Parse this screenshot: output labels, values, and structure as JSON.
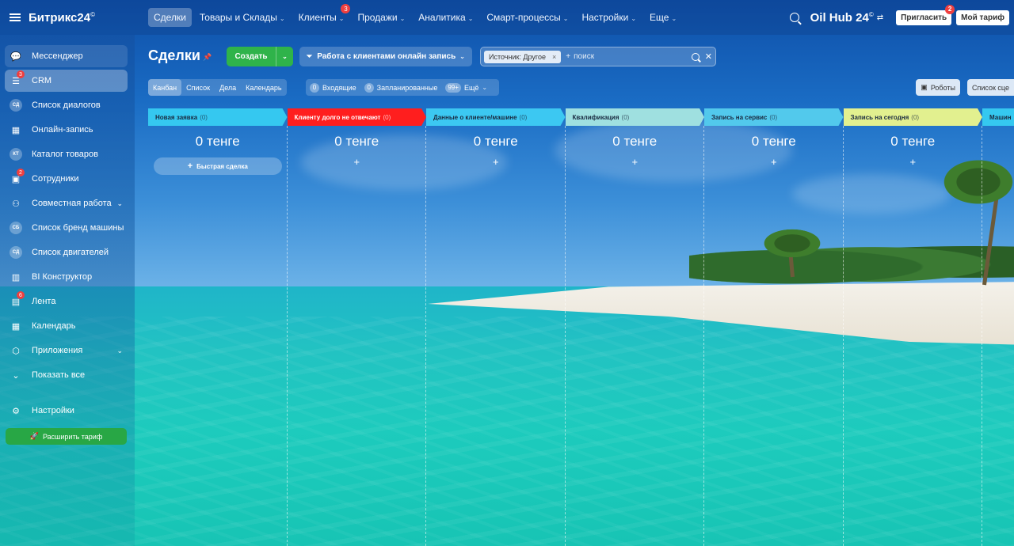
{
  "topbar": {
    "logo": "Битрикс24",
    "logo_mark": "©",
    "nav": [
      {
        "label": "Сделки",
        "active": true,
        "chevron": false
      },
      {
        "label": "Товары и Склады",
        "chevron": true
      },
      {
        "label": "Клиенты",
        "chevron": true,
        "badge": "3"
      },
      {
        "label": "Продажи",
        "chevron": true
      },
      {
        "label": "Аналитика",
        "chevron": true
      },
      {
        "label": "Смарт-процессы",
        "chevron": true
      },
      {
        "label": "Настройки",
        "chevron": true
      },
      {
        "label": "Еще",
        "chevron": true
      }
    ],
    "brand": "Oil Hub",
    "brand_num": "24",
    "brand_mark": "©",
    "invite_label": "Пригласить",
    "invite_badge": "2",
    "tariff_label": "Мой тариф"
  },
  "sidebar": {
    "items": [
      {
        "label": "Мессенджер",
        "icon": "chat-icon",
        "glyph": "💬",
        "style": "hl"
      },
      {
        "label": "CRM",
        "icon": "filter-icon",
        "glyph": "☰",
        "style": "active",
        "badge": "3"
      },
      {
        "label": "Список диалогов",
        "icon": "СД",
        "circle": true
      },
      {
        "label": "Онлайн-запись",
        "icon": "calendar-icon",
        "glyph": "▦"
      },
      {
        "label": "Каталог товаров",
        "icon": "КТ",
        "circle": true
      },
      {
        "label": "Сотрудники",
        "icon": "users-icon",
        "glyph": "▣",
        "badge": "2"
      },
      {
        "label": "Совместная работа",
        "icon": "team-icon",
        "glyph": "⚇",
        "chevron": true
      },
      {
        "label": "Список бренд машины",
        "icon": "СБ",
        "circle": true
      },
      {
        "label": "Список двигателей",
        "icon": "СД",
        "circle": true
      },
      {
        "label": "BI Конструктор",
        "icon": "bar-chart-icon",
        "glyph": "▥"
      },
      {
        "label": "Лента",
        "icon": "feed-icon",
        "glyph": "▤",
        "badge": "6"
      },
      {
        "label": "Календарь",
        "icon": "calendar-icon",
        "glyph": "▦"
      },
      {
        "label": "Приложения",
        "icon": "cube-icon",
        "glyph": "⬡",
        "chevron": true
      },
      {
        "label": "Показать все",
        "icon": "chevron-down-icon",
        "glyph": "⌄"
      }
    ],
    "settings_label": "Настройки",
    "upgrade_label": "Расширить тариф"
  },
  "header": {
    "title": "Сделки",
    "create_label": "Создать",
    "funnel_label": "Работа с клиентами онлайн запись",
    "filter_chip": "Источник: Другое",
    "search_placeholder": "поиск"
  },
  "views": {
    "tabs": [
      "Канбан",
      "Список",
      "Дела",
      "Календарь"
    ],
    "active": "Канбан",
    "counters": [
      {
        "count": "0",
        "label": "Входящие"
      },
      {
        "count": "0",
        "label": "Запланированные"
      },
      {
        "count": "99+",
        "label": "Ещё"
      }
    ],
    "robots_label": "Роботы",
    "list_label": "Список сце"
  },
  "kanban": {
    "quick_deal_label": "Быстрая сделка",
    "columns": [
      {
        "title": "Новая заявка",
        "count": "(0)",
        "sum": "0 тенге",
        "color": "#35c8f0"
      },
      {
        "title": "Клиенту долго не отвечают",
        "count": "(0)",
        "sum": "0 тенге",
        "color": "#ff1e1e"
      },
      {
        "title": "Данные о клиенте/машине",
        "count": "(0)",
        "sum": "0 тенге",
        "color": "#3cc8f2"
      },
      {
        "title": "Квалификация",
        "count": "(0)",
        "sum": "0 тенге",
        "color": "#9fe0e0"
      },
      {
        "title": "Запись на сервис",
        "count": "(0)",
        "sum": "0 тенге",
        "color": "#52c9ec"
      },
      {
        "title": "Запись на сегодня",
        "count": "(0)",
        "sum": "0 тенге",
        "color": "#e2f08f"
      },
      {
        "title": "Машин",
        "count": "",
        "sum": "",
        "color": "#35c8f0"
      }
    ]
  }
}
